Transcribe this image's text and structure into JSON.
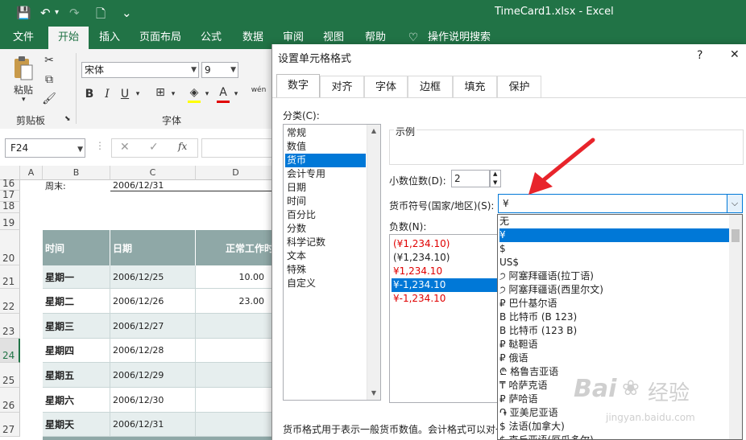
{
  "window": {
    "title": "TimeCard1.xlsx  -  Excel"
  },
  "quick_access": {
    "save_icon": "💾",
    "undo_icon": "↶",
    "redo_icon": "↷",
    "new_icon": "🗋",
    "customize_icon": "⌄"
  },
  "ribbon_tabs": [
    "文件",
    "开始",
    "插入",
    "页面布局",
    "公式",
    "数据",
    "审阅",
    "视图",
    "帮助",
    "操作说明搜索"
  ],
  "ribbon": {
    "paste_label": "粘贴",
    "clipboard_group": "剪贴板",
    "font_group": "字体",
    "font_name": "宋体",
    "font_size": "9",
    "bold": "B",
    "italic": "I",
    "underline": "U",
    "font_color_glyph": "A",
    "phonetic_glyph": "wén"
  },
  "formula_bar": {
    "name_box": "F24",
    "fx": "fx"
  },
  "sheet": {
    "columns": [
      "A",
      "B",
      "C",
      "D"
    ],
    "rows": [
      "16",
      "17",
      "18",
      "19",
      "20",
      "21",
      "22",
      "23",
      "24",
      "25",
      "26",
      "27"
    ],
    "week_end_label": "周末:",
    "week_end_value": "2006/12/31",
    "header": {
      "time": "时间",
      "date": "日期",
      "normal": "正常工作时"
    },
    "data_rows": [
      {
        "day": "星期一",
        "date": "2006/12/25",
        "hours": "10.00"
      },
      {
        "day": "星期二",
        "date": "2006/12/26",
        "hours": "23.00"
      },
      {
        "day": "星期三",
        "date": "2006/12/27",
        "hours": ""
      },
      {
        "day": "星期四",
        "date": "2006/12/28",
        "hours": ""
      },
      {
        "day": "星期五",
        "date": "2006/12/29",
        "hours": ""
      },
      {
        "day": "星期六",
        "date": "2006/12/30",
        "hours": ""
      },
      {
        "day": "星期天",
        "date": "2006/12/31",
        "hours": ""
      }
    ]
  },
  "dialog": {
    "title": "设置单元格格式",
    "help": "?",
    "close": "✕",
    "tabs": [
      "数字",
      "对齐",
      "字体",
      "边框",
      "填充",
      "保护"
    ],
    "category_label": "分类(C):",
    "categories": [
      "常规",
      "数值",
      "货币",
      "会计专用",
      "日期",
      "时间",
      "百分比",
      "分数",
      "科学记数",
      "文本",
      "特殊",
      "自定义"
    ],
    "sample_label": "示例",
    "decimal_label": "小数位数(D):",
    "decimal_value": "2",
    "symbol_label": "货币符号(国家/地区)(S):",
    "symbol_value": "¥",
    "negative_label": "负数(N):",
    "negatives": [
      "(¥1,234.10)",
      "(¥1,234.10)",
      "¥1,234.10",
      "¥-1,234.10",
      "¥-1,234.10"
    ],
    "symbol_options": [
      "无",
      "¥",
      "$",
      "US$",
      "੭ 阿塞拜疆语(拉丁语)",
      "੭ 阿塞拜疆语(西里尔文)",
      "₽ 巴什基尔语",
      "B 比特币 (B 123)",
      "B 比特币 (123 B)",
      "₽ 鞑靼语",
      "₽ 俄语",
      "₾ 格鲁吉亚语",
      "₸ 哈萨克语",
      "₽ 萨哈语",
      "֏ 亚美尼亚语",
      "$ 法语(加拿大)",
      "$ 克丘亚语(厄瓜多尔)"
    ],
    "description": "货币格式用于表示一般货币数值。会计格式可以对一列数值进行小数点对齐。"
  },
  "watermark": {
    "brand": "Bai",
    "brand2": "经验",
    "url": "jingyan.baidu.com"
  },
  "colors": {
    "excel_green": "#217346",
    "selection_blue": "#0078d7",
    "negative_red": "#e00000",
    "header_fill": "#8fa8a7",
    "row_fill": "#e6eeee",
    "arrow_red": "#e8242b"
  }
}
